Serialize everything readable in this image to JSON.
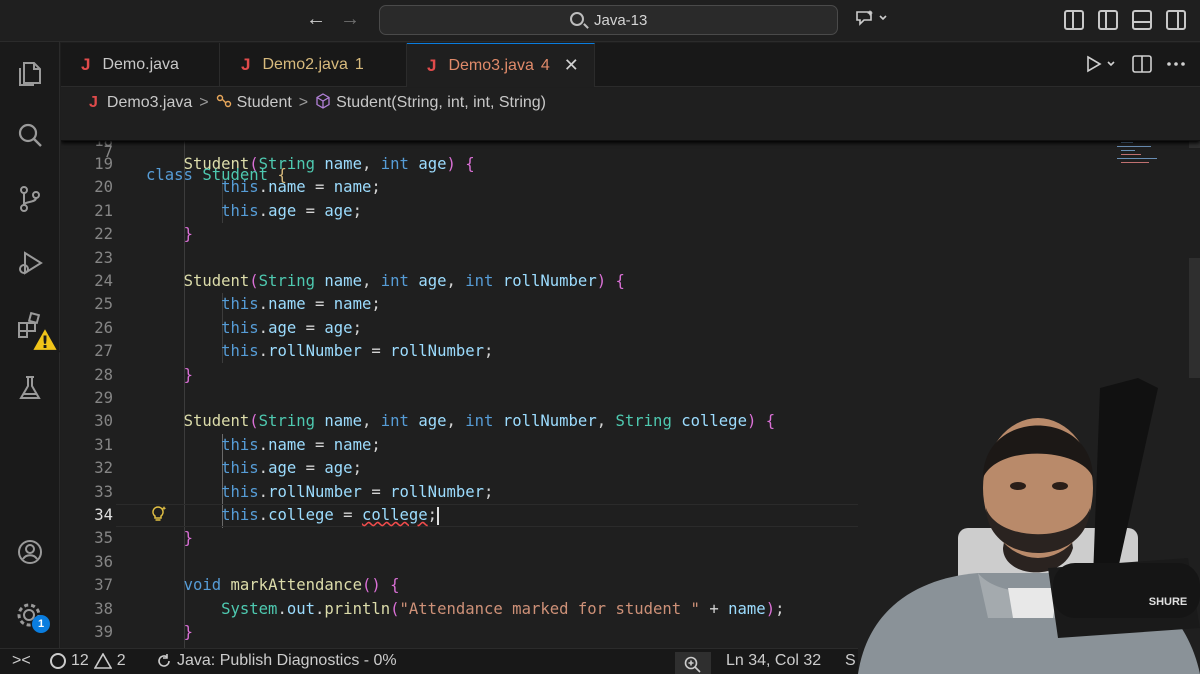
{
  "titlebar": {
    "back_glyph": "←",
    "forward_glyph": "→",
    "search_title": "Java-13",
    "icons": [
      "copilot-icon",
      "customize-layout-icon",
      "toggle-primary-sidebar-icon",
      "toggle-panel-icon",
      "toggle-secondary-sidebar-icon"
    ]
  },
  "activity_bar": {
    "items": [
      "explorer-icon",
      "search-icon",
      "source-control-icon",
      "run-debug-icon",
      "extensions-icon",
      "testing-icon"
    ],
    "bottom": [
      "accounts-icon",
      "manage-icon"
    ],
    "extensions_warning": "!",
    "manage_badge": "1"
  },
  "tabs": [
    {
      "icon": "J",
      "label": "Demo.java",
      "badge": ""
    },
    {
      "icon": "J",
      "label": "Demo2.java",
      "badge": "1"
    },
    {
      "icon": "J",
      "label": "Demo3.java",
      "badge": "4",
      "close": "✕"
    }
  ],
  "breadcrumb": {
    "file_icon": "J",
    "file": "Demo3.java",
    "sep": ">",
    "class": "Student",
    "method": "Student(String, int, int, String)"
  },
  "editor": {
    "sticky_line": {
      "number": "7",
      "text": "class Student {"
    },
    "partial_line_number": "18",
    "current_line": "34",
    "lines": [
      {
        "n": "19",
        "text": "    Student(String name, int age) {"
      },
      {
        "n": "20",
        "text": "        this.name = name;"
      },
      {
        "n": "21",
        "text": "        this.age = age;"
      },
      {
        "n": "22",
        "text": "    }"
      },
      {
        "n": "23",
        "text": ""
      },
      {
        "n": "24",
        "text": "    Student(String name, int age, int rollNumber) {"
      },
      {
        "n": "25",
        "text": "        this.name = name;"
      },
      {
        "n": "26",
        "text": "        this.age = age;"
      },
      {
        "n": "27",
        "text": "        this.rollNumber = rollNumber;"
      },
      {
        "n": "28",
        "text": "    }"
      },
      {
        "n": "29",
        "text": ""
      },
      {
        "n": "30",
        "text": "    Student(String name, int age, int rollNumber, String college) {"
      },
      {
        "n": "31",
        "text": "        this.name = name;"
      },
      {
        "n": "32",
        "text": "        this.age = age;"
      },
      {
        "n": "33",
        "text": "        this.rollNumber = rollNumber;"
      },
      {
        "n": "34",
        "text": "        this.college = college;"
      },
      {
        "n": "35",
        "text": "    }"
      },
      {
        "n": "36",
        "text": ""
      },
      {
        "n": "37",
        "text": "    void markAttendance() {"
      },
      {
        "n": "38",
        "text": "        System.out.println(\"Attendance marked for student \" + name);"
      },
      {
        "n": "39",
        "text": "    }"
      }
    ]
  },
  "statusbar": {
    "remote_glyph": "><",
    "errors": "12",
    "warnings": "2",
    "java_status": "Java: Publish Diagnostics - 0%",
    "position": "Ln 34, Col 32",
    "trailing": "S"
  },
  "webcam": {
    "description_icon": "webcam-person",
    "mic_brand": "SHURE"
  },
  "colors": {
    "accent": "#0a7ddf",
    "keyword": "#569cd6",
    "type": "#4ec9b0",
    "function": "#dcdcaa",
    "variable": "#9cdcfe",
    "string": "#ce9178",
    "error": "#f14c4c"
  }
}
